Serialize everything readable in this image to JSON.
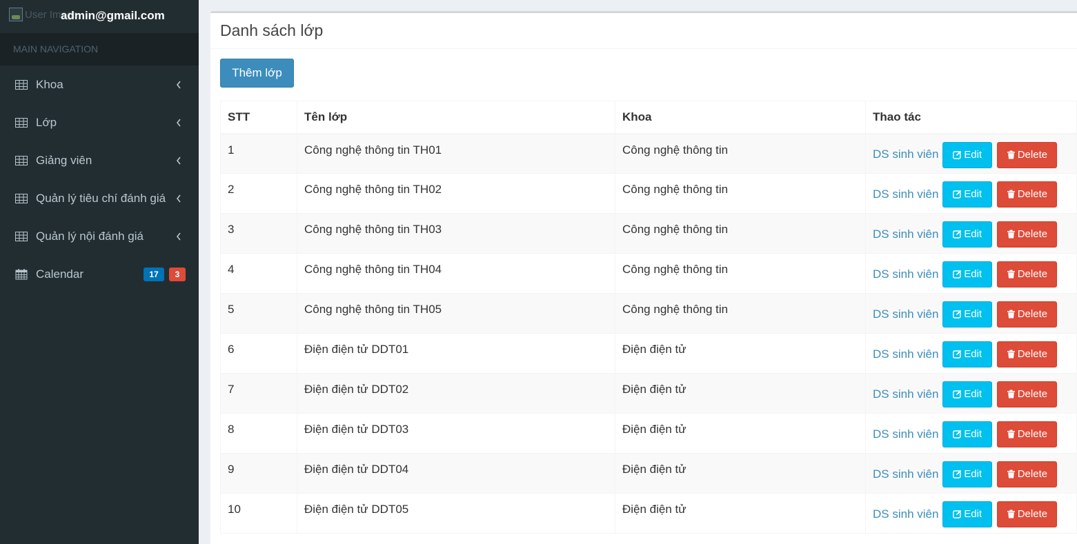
{
  "user": {
    "image_alt": "User Image",
    "email": "admin@gmail.com"
  },
  "sidebar": {
    "header": "MAIN NAVIGATION",
    "items": [
      {
        "label": "Khoa",
        "icon": "table-icon"
      },
      {
        "label": "Lớp",
        "icon": "table-icon"
      },
      {
        "label": "Giảng viên",
        "icon": "table-icon"
      },
      {
        "label": "Quản lý tiêu chí đánh giá",
        "icon": "table-icon"
      },
      {
        "label": "Quản lý nội đánh giá",
        "icon": "table-icon"
      }
    ],
    "calendar": {
      "label": "Calendar",
      "icon": "calendar-icon",
      "badge_blue": "17",
      "badge_red": "3"
    }
  },
  "main": {
    "title": "Danh sách lớp",
    "add_button": "Thêm lớp",
    "table": {
      "headers": [
        "STT",
        "Tên lớp",
        "Khoa",
        "Thao tác"
      ],
      "rows": [
        {
          "stt": "1",
          "ten_lop": "Công nghệ thông tin TH01",
          "khoa": "Công nghệ thông tin"
        },
        {
          "stt": "2",
          "ten_lop": "Công nghệ thông tin TH02",
          "khoa": "Công nghệ thông tin"
        },
        {
          "stt": "3",
          "ten_lop": "Công nghệ thông tin TH03",
          "khoa": "Công nghệ thông tin"
        },
        {
          "stt": "4",
          "ten_lop": "Công nghệ thông tin TH04",
          "khoa": "Công nghệ thông tin"
        },
        {
          "stt": "5",
          "ten_lop": "Công nghệ thông tin TH05",
          "khoa": "Công nghệ thông tin"
        },
        {
          "stt": "6",
          "ten_lop": "Điện điện tử DDT01",
          "khoa": "Điện điện tử"
        },
        {
          "stt": "7",
          "ten_lop": "Điện điện tử DDT02",
          "khoa": "Điện điện tử"
        },
        {
          "stt": "8",
          "ten_lop": "Điện điện tử DDT03",
          "khoa": "Điện điện tử"
        },
        {
          "stt": "9",
          "ten_lop": "Điện điện tử DDT04",
          "khoa": "Điện điện tử"
        },
        {
          "stt": "10",
          "ten_lop": "Điện điện tử DDT05",
          "khoa": "Điện điện tử"
        }
      ],
      "action_labels": {
        "students": "DS sinh viên",
        "edit": "Edit",
        "delete": "Delete"
      }
    }
  },
  "colors": {
    "sidebar_bg": "#222d32",
    "primary": "#3c8dbc",
    "info": "#00c0ef",
    "danger": "#dd4b39"
  }
}
